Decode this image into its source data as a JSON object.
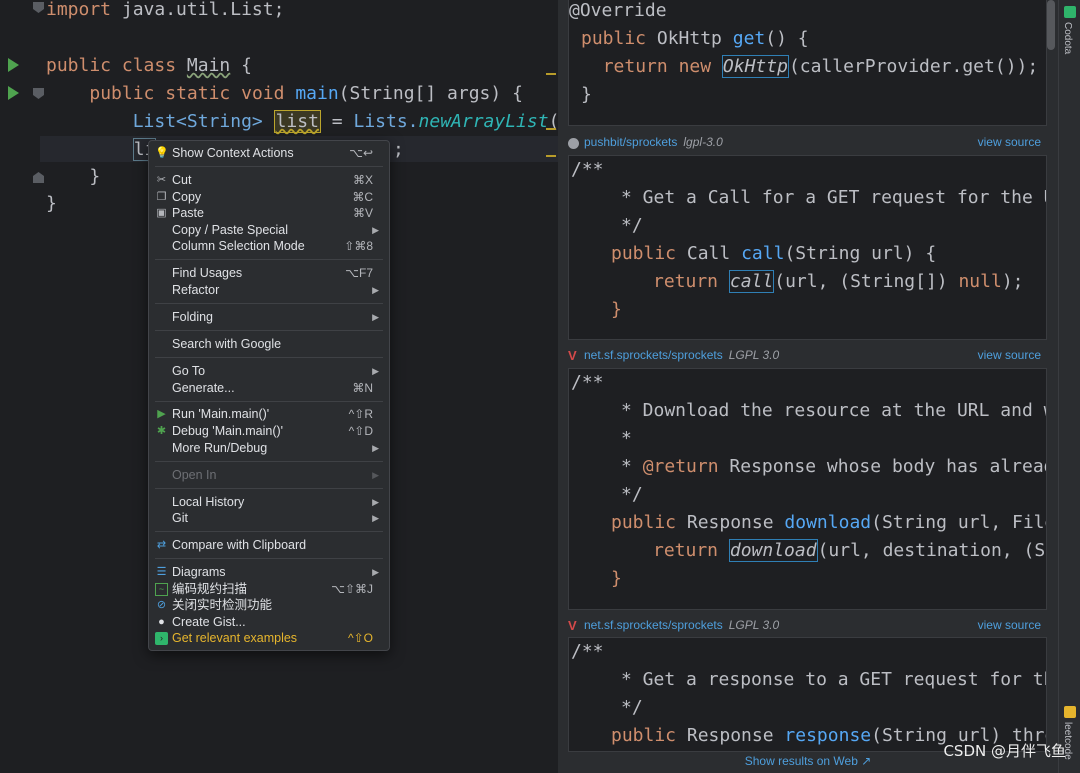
{
  "editor": {
    "lines": {
      "import_kw": "import",
      "import_rest": "java.util.List;",
      "class_public": "public",
      "class_kw": "class",
      "class_name": "Main",
      "brace_open": "{",
      "main_public": "public",
      "main_static": "static",
      "main_void": "void",
      "main_name": "main",
      "main_params": "(String[] args) {",
      "decl_type": "List<String>",
      "decl_var": "list",
      "decl_eq": "=",
      "decl_rhs_cls": "Lists.",
      "decl_rhs_fn": "newArrayList",
      "decl_rhs_end": "();",
      "cur_prefix": "li",
      "cur_suffix": ";",
      "close_inner": "}",
      "close_outer": "}"
    }
  },
  "context_menu": {
    "show_context_actions": {
      "label": "Show Context Actions",
      "shortcut": "⌥↩"
    },
    "cut": {
      "label": "Cut",
      "shortcut": "⌘X"
    },
    "copy": {
      "label": "Copy",
      "shortcut": "⌘C"
    },
    "paste": {
      "label": "Paste",
      "shortcut": "⌘V"
    },
    "copy_paste_special": {
      "label": "Copy / Paste Special"
    },
    "column_selection": {
      "label": "Column Selection Mode",
      "shortcut": "⇧⌘8"
    },
    "find_usages": {
      "label": "Find Usages",
      "shortcut": "⌥F7"
    },
    "refactor": {
      "label": "Refactor"
    },
    "folding": {
      "label": "Folding"
    },
    "search_google": {
      "label": "Search with Google"
    },
    "go_to": {
      "label": "Go To"
    },
    "generate": {
      "label": "Generate...",
      "shortcut": "⌘N"
    },
    "run_main": {
      "label": "Run 'Main.main()'",
      "shortcut": "^⇧R"
    },
    "debug_main": {
      "label": "Debug 'Main.main()'",
      "shortcut": "^⇧D"
    },
    "more_run_debug": {
      "label": "More Run/Debug"
    },
    "open_in": {
      "label": "Open In"
    },
    "local_history": {
      "label": "Local History"
    },
    "git": {
      "label": "Git"
    },
    "compare_clipboard": {
      "label": "Compare with Clipboard"
    },
    "diagrams": {
      "label": "Diagrams"
    },
    "code_scan": {
      "label": "编码规约扫描",
      "shortcut": "⌥⇧⌘J"
    },
    "close_realtime": {
      "label": "关闭实时检测功能"
    },
    "create_gist": {
      "label": "Create Gist..."
    },
    "relevant_examples": {
      "label": "Get relevant examples",
      "shortcut": "^⇧O"
    }
  },
  "panel": {
    "card1": {
      "annotation": "@Override",
      "l2_kw": "public",
      "l2_rest": "OkHttp",
      "l2_fn": "get",
      "l2_end": "() {",
      "l3_kw1": "return",
      "l3_kw2": "new",
      "l3_boxed": "OkHttp",
      "l3_rest": "(callerProvider.get());",
      "l4": "}"
    },
    "source1": {
      "repo": "pushbit/sprockets",
      "license": "lgpl-3.0",
      "view": "view source"
    },
    "card2": {
      "c1": "/**",
      "c2": "* Get a Call for a GET request for the UR",
      "c3": "*/",
      "l4_kw": "public",
      "l4_rest": "Call",
      "l4_fn": "call",
      "l4_end": "(String url) {",
      "l5_kw": "return",
      "l5_boxed": "call",
      "l5_mid": "(url, (String[])",
      "l5_null": "null",
      "l5_end": ");",
      "l6": "}"
    },
    "source2": {
      "repo": "net.sf.sprockets/sprockets",
      "license": "LGPL 3.0",
      "view": "view source"
    },
    "card3": {
      "c1": "/**",
      "c2": "* Download the resource at the URL and wr",
      "c3": "*",
      "c4_star": "*",
      "c4_tag": "@return",
      "c4_rest": "Response whose body has already",
      "c5": "*/",
      "l6_kw": "public",
      "l6_rest": "Response",
      "l6_fn": "download",
      "l6_end": "(String url, File",
      "l7_kw": "return",
      "l7_boxed": "download",
      "l7_end": "(url, destination, (Str",
      "l8": "}"
    },
    "source3": {
      "repo": "net.sf.sprockets/sprockets",
      "license": "LGPL 3.0",
      "view": "view source"
    },
    "card4": {
      "c1": "/**",
      "c2": "* Get a response to a GET request for the",
      "c3": "*/",
      "l4_kw": "public",
      "l4_rest": "Response",
      "l4_fn": "response",
      "l4_end": "(String url) throw"
    },
    "show_web": "Show results on Web ↗"
  },
  "side_strip": {
    "top_tab": "Codota",
    "bottom_tab": "leetcode"
  },
  "watermark": "CSDN @月伴飞鱼",
  "colors": {
    "accent_link": "#4e9fdd",
    "keyword": "#cf8e6d",
    "function": "#56a8f5",
    "run_green": "#4fa34f",
    "highlight_yellow": "#e6b52d"
  }
}
